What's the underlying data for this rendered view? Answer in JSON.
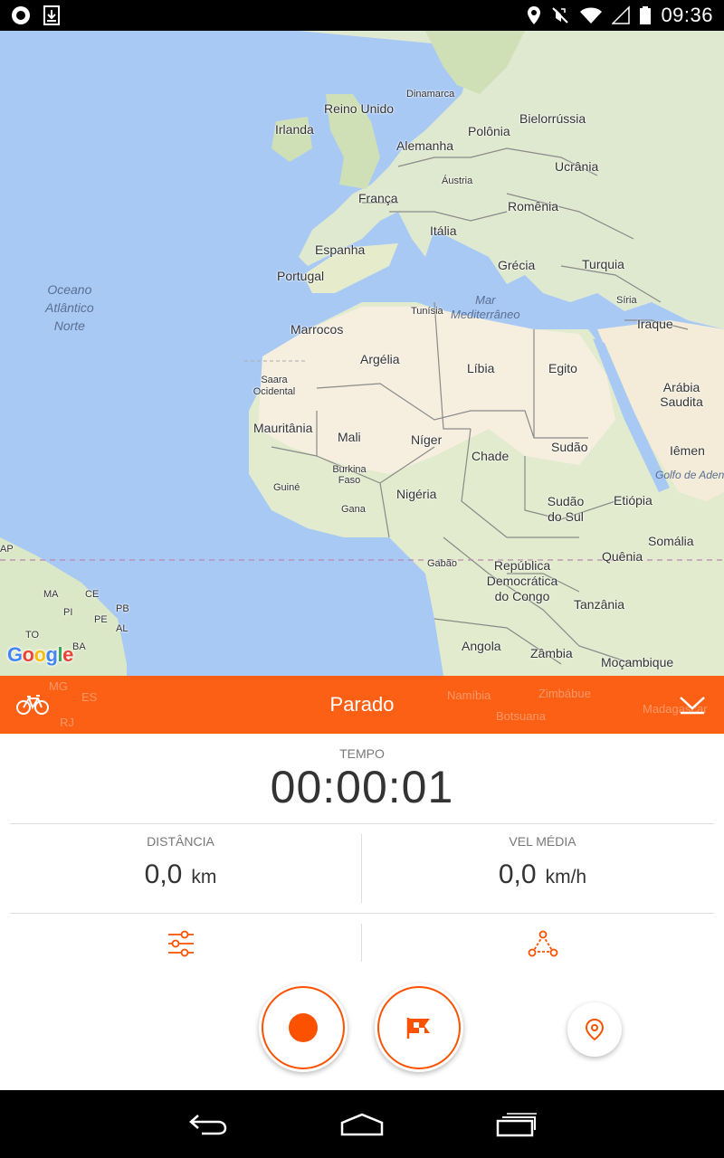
{
  "status_bar": {
    "time": "09:36",
    "icons": [
      "record-indicator-icon",
      "download-icon",
      "location-icon",
      "mute-icon",
      "wifi-icon",
      "signal-icon",
      "battery-icon"
    ]
  },
  "map": {
    "logo": "Google",
    "ocean_label": [
      "Oceano",
      "Atlântico",
      "Norte"
    ],
    "sea_label": [
      "Mar",
      "Mediterrâneo"
    ],
    "gulf_label": "Golfo de Aden",
    "labels": [
      "Dinamarca",
      "Reino Unido",
      "Irlanda",
      "Bielorrússia",
      "Polônia",
      "Alemanha",
      "Ucrânia",
      "Áustria",
      "França",
      "Romênia",
      "Itália",
      "Espanha",
      "Portugal",
      "Grécia",
      "Turquia",
      "Tunísia",
      "Síria",
      "Iraque",
      "Marrocos",
      "Argélia",
      "Líbia",
      "Egito",
      "Saara Ocidental",
      "Arábia Saudita",
      "Mauritânia",
      "Mali",
      "Níger",
      "Chade",
      "Sudão",
      "Iêmen",
      "Burkina Faso",
      "Guiné",
      "Gana",
      "Nigéria",
      "Sudão do Sul",
      "Etiópia",
      "Somália",
      "Quênia",
      "Gabão",
      "República Democrática do Congo",
      "Tanzânia",
      "Angola",
      "Zâmbia",
      "Moçambique",
      "AP",
      "MA",
      "CE",
      "PI",
      "PB",
      "PE",
      "AL",
      "TO",
      "BA",
      "MG",
      "ES",
      "RJ",
      "Namíbia",
      "Zimbábue",
      "Botsuana",
      "Madagascar"
    ]
  },
  "activity_bar": {
    "title": "Parado",
    "sport_icon": "bicycle-icon",
    "collapse_icon": "collapse-chevron-icon"
  },
  "stats": {
    "time_label": "TEMPO",
    "time_value": "00:00:01",
    "distance_label": "DISTÂNCIA",
    "distance_value": "0,0",
    "distance_unit": "km",
    "speed_label": "VEL MÉDIA",
    "speed_value": "0,0",
    "speed_unit": "km/h"
  },
  "controls": {
    "settings_icon": "sliders-icon",
    "route_icon": "route-icon",
    "record_icon": "record-icon",
    "finish_icon": "finish-flag-icon",
    "location_icon": "location-pin-icon"
  },
  "colors": {
    "accent": "#fc5200",
    "water": "#a9c9f5",
    "land": "#e4ecd6",
    "desert": "#f7f0e2"
  }
}
